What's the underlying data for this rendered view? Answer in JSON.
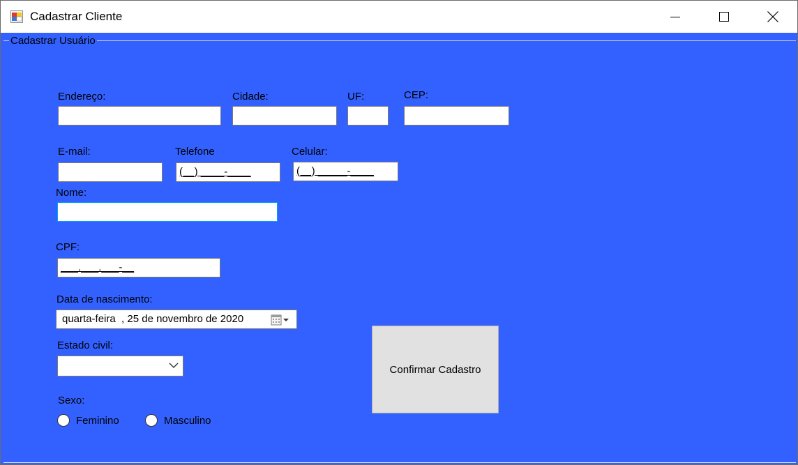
{
  "window": {
    "title": "Cadastrar Cliente",
    "icons": {
      "app": "form-app-icon",
      "minimize": "minimize-icon",
      "maximize": "maximize-icon",
      "close": "close-icon"
    }
  },
  "group": {
    "legend": "Cadastrar Usuário"
  },
  "labels": {
    "endereco": "Endereço:",
    "cidade": "Cidade:",
    "uf": "UF:",
    "cep": "CEP:",
    "email": "E-mail:",
    "telefone": "Telefone",
    "celular": "Celular:",
    "nome": "Nome:",
    "cpf": "CPF:",
    "data_nascimento": "Data de nascimento:",
    "estado_civil": "Estado civil:",
    "sexo": "Sexo:"
  },
  "fields": {
    "endereco": "",
    "cidade": "",
    "uf": "",
    "cep": "",
    "email": "",
    "telefone_mask": "(__) ____-____",
    "celular_mask": "(__) _____-____",
    "nome": "",
    "cpf_mask": "___.___.___-__",
    "data_nascimento": "quarta-feira  , 25 de novembro de 2020",
    "estado_civil": ""
  },
  "radios": [
    {
      "label": "Feminino",
      "checked": false
    },
    {
      "label": "Masculino",
      "checked": false
    }
  ],
  "button": {
    "confirmar": "Confirmar Cadastro"
  },
  "colors": {
    "form_background": "#3361ff",
    "focus_border": "#00a2ff",
    "button_face": "#e1e1e1"
  }
}
